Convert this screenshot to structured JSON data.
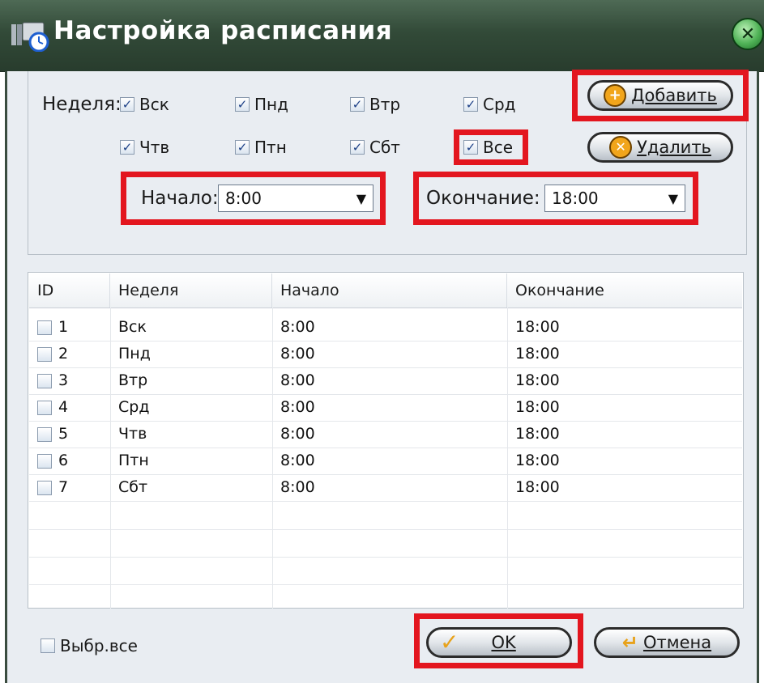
{
  "window": {
    "title": "Настройка расписания",
    "close_icon": "close-x-icon",
    "title_icon": "schedule-clock-icon"
  },
  "week": {
    "label": "Неделя:",
    "days": [
      {
        "label": "Вск",
        "checked": true
      },
      {
        "label": "Пнд",
        "checked": true
      },
      {
        "label": "Втр",
        "checked": true
      },
      {
        "label": "Срд",
        "checked": true
      },
      {
        "label": "Чтв",
        "checked": true
      },
      {
        "label": "Птн",
        "checked": true
      },
      {
        "label": "Сбт",
        "checked": true
      },
      {
        "label": "Все",
        "checked": true
      }
    ]
  },
  "buttons": {
    "add": "Добавить",
    "delete": "Удалить",
    "ok": "OK",
    "cancel": "Отмена"
  },
  "time": {
    "start_label": "Начало:",
    "start_value": "8:00",
    "end_label": "Окончание:",
    "end_value": "18:00"
  },
  "table": {
    "columns": [
      "ID",
      "Неделя",
      "Начало",
      "Окончание"
    ],
    "rows": [
      {
        "id": "1",
        "week": "Вск",
        "start": "8:00",
        "end": "18:00"
      },
      {
        "id": "2",
        "week": "Пнд",
        "start": "8:00",
        "end": "18:00"
      },
      {
        "id": "3",
        "week": "Втр",
        "start": "8:00",
        "end": "18:00"
      },
      {
        "id": "4",
        "week": "Срд",
        "start": "8:00",
        "end": "18:00"
      },
      {
        "id": "5",
        "week": "Чтв",
        "start": "8:00",
        "end": "18:00"
      },
      {
        "id": "6",
        "week": "Птн",
        "start": "8:00",
        "end": "18:00"
      },
      {
        "id": "7",
        "week": "Сбт",
        "start": "8:00",
        "end": "18:00"
      }
    ]
  },
  "select_all": "Выбр.все",
  "colors": {
    "title_bar": "#324a38",
    "highlight": "#e3161f",
    "check": "#1c3f86"
  }
}
